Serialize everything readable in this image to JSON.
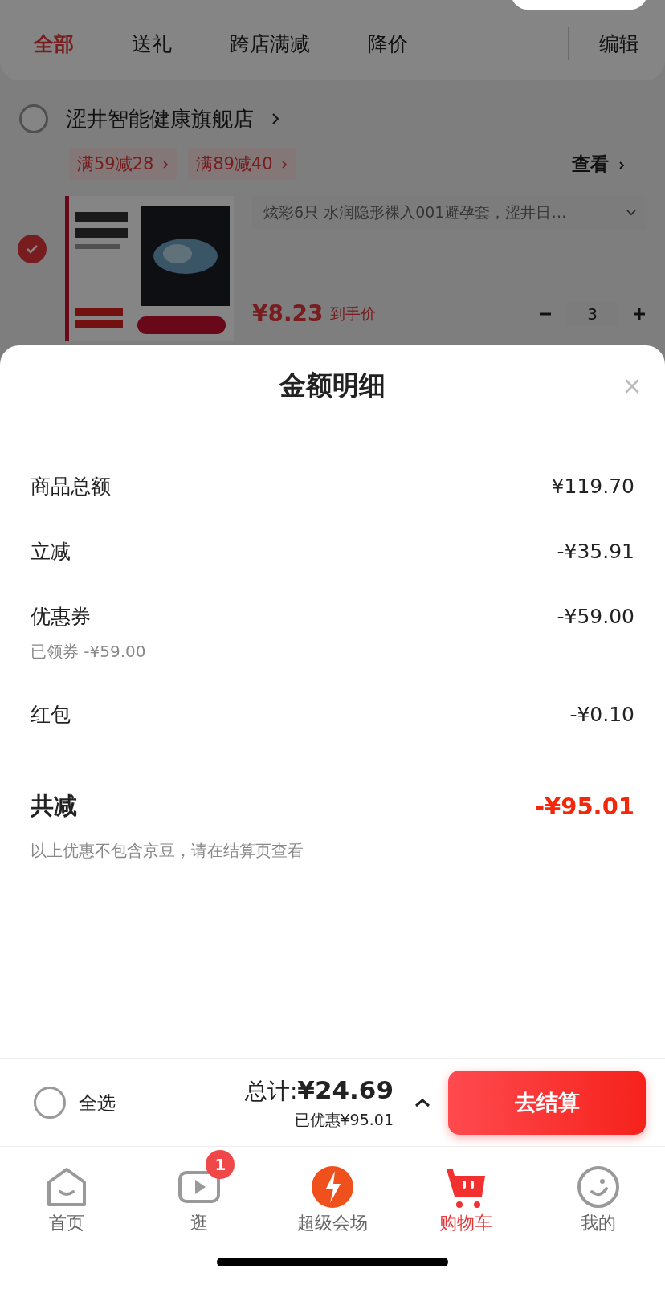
{
  "filter_tabs": [
    {
      "label": "全部",
      "selected": true
    },
    {
      "label": "送礼",
      "selected": false
    },
    {
      "label": "跨店满减",
      "selected": false
    },
    {
      "label": "降价",
      "selected": false
    }
  ],
  "edit_button": "编辑",
  "store": {
    "name": "涩井智能健康旗舰店",
    "checked": false
  },
  "coupons": [
    "满59减28",
    "满89减40"
  ],
  "view_link": "查看",
  "product": {
    "checked": true,
    "kind": "picture",
    "title": "炫彩6只 水润隐形裸入001避孕套，涩井日…",
    "price": "¥8.23",
    "price_label": "到手价",
    "quantity": "3"
  },
  "sheet": {
    "title": "金额明细",
    "rows": [
      {
        "label": "商品总额",
        "amount": "¥119.70"
      },
      {
        "label": "立减",
        "amount": "-¥35.91"
      },
      {
        "label": "优惠券",
        "amount": "-¥59.00",
        "note": "已领券 -¥59.00"
      },
      {
        "label": "红包",
        "amount": "-¥0.10"
      }
    ],
    "total": {
      "label": "共减",
      "amount": "-¥95.01"
    },
    "note": "以上优惠不包含京豆，请在结算页查看"
  },
  "checkout": {
    "select_all": {
      "label": "全选",
      "checked": false
    },
    "total_label": "总计:",
    "total": "¥24.69",
    "saved": "已优惠¥95.01",
    "button": "去结算"
  },
  "tab_bar": [
    {
      "kind": "home",
      "label": "首页",
      "selected": false
    },
    {
      "kind": "video",
      "label": "逛",
      "selected": false,
      "badge": "1"
    },
    {
      "kind": "deals",
      "label": "超级会场",
      "selected": false
    },
    {
      "kind": "cart",
      "label": "购物车",
      "selected": true
    },
    {
      "kind": "me",
      "label": "我的",
      "selected": false
    }
  ]
}
